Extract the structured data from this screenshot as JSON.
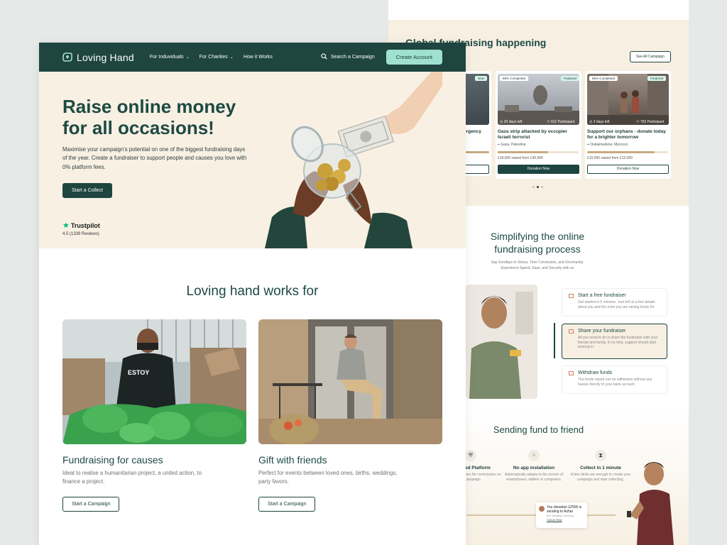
{
  "back": {
    "global": {
      "title": "Global fundraising happening hand",
      "see_all": "See All Campaign",
      "campaigns": [
        {
          "badge_left": "",
          "badge_right": "New",
          "title": "ergency",
          "days": "",
          "participants": "",
          "location": "",
          "raised": "",
          "button": ""
        },
        {
          "badge_left": "88% Completed",
          "badge_right": "Featured",
          "title": "Gaza strip attacked by occupier Israeli terrorist",
          "days": "20 days left",
          "participants": "912 Participant",
          "location": "Gaza, Palestine",
          "raised": "£18,500 raised from £30,000",
          "button": "Donation Now"
        },
        {
          "badge_left": "85% Completed",
          "badge_right": "Featured",
          "title": "Support our orphans - donate today for a brighter tomorrow",
          "days": "2 days left",
          "participants": "753 Participant",
          "location": "Oukaimedene, Morocco",
          "raised": "£10,000 raised from £12,000",
          "button": "Donation Now"
        }
      ]
    },
    "simplify": {
      "title1": "Simplifying the online",
      "title2": "fundraising process",
      "sub1": "Say Goodbye to Stress, Time Constraints, and Uncertainty.",
      "sub2": "Experience Speed, Ease, and Security with us",
      "steps": [
        {
          "title": "Start a free fundraiser",
          "desc": "Get started in 5 minutes. Just tell us a few details about you and the ones you are raising funds for."
        },
        {
          "title": "Share your fundraiser",
          "desc": "All you need to do is share the fundraiser with your friends and family. In no time, support should start pouring in."
        },
        {
          "title": "Withdraw funds",
          "desc": "The funds raised can be withdrawn without any hassle directly to your bank account."
        }
      ]
    },
    "sending": {
      "title": "Sending fund to friend",
      "features": [
        {
          "title": "ed Platform",
          "desc": "ees No commission ne campaign."
        },
        {
          "title": "No app installation",
          "desc": "Automatically adapts to the screen of smartphones, tablets or computers."
        },
        {
          "title": "Collect in 1 minute",
          "desc": "A few clicks are enough to create your campaign and start collecting."
        }
      ],
      "notif": {
        "text": "You donation £2500 is sending to Azhar",
        "sub": "Ref: Wedding Ceremony",
        "cancel": "Cancel Now"
      }
    }
  },
  "nav": {
    "logo": "Loving Hand",
    "menu": [
      "For Induviduals",
      "For Charities",
      "How it Works"
    ],
    "search": "Search a Campaign",
    "create": "Create Account"
  },
  "hero": {
    "title": "Raise online money for all occasions!",
    "desc": "Maximise your campaign's potential on one of the biggest fundraising days of the year. Create a fundraiser to support people and causes you love with 0% platform fees.",
    "button": "Start a Collect",
    "trustpilot": "Trustpilot",
    "rating": "4.5 (1339 Reviews)"
  },
  "works": {
    "title": "Loving hand works for",
    "cards": [
      {
        "title": "Fundraising for causes",
        "desc": "Ideal to realise a humanitarian project, a united action, to finance a project.",
        "button": "Start a Campaign"
      },
      {
        "title": "Gift with friends",
        "desc": "Perfect for events between loved ones, births, weddings, party favors.",
        "button": "Start a Campaign"
      }
    ]
  },
  "colors": {
    "primary": "#1e453f",
    "accent": "#9fe0cf",
    "beige": "#f8f0e3",
    "trustpilot": "#00b67a"
  }
}
